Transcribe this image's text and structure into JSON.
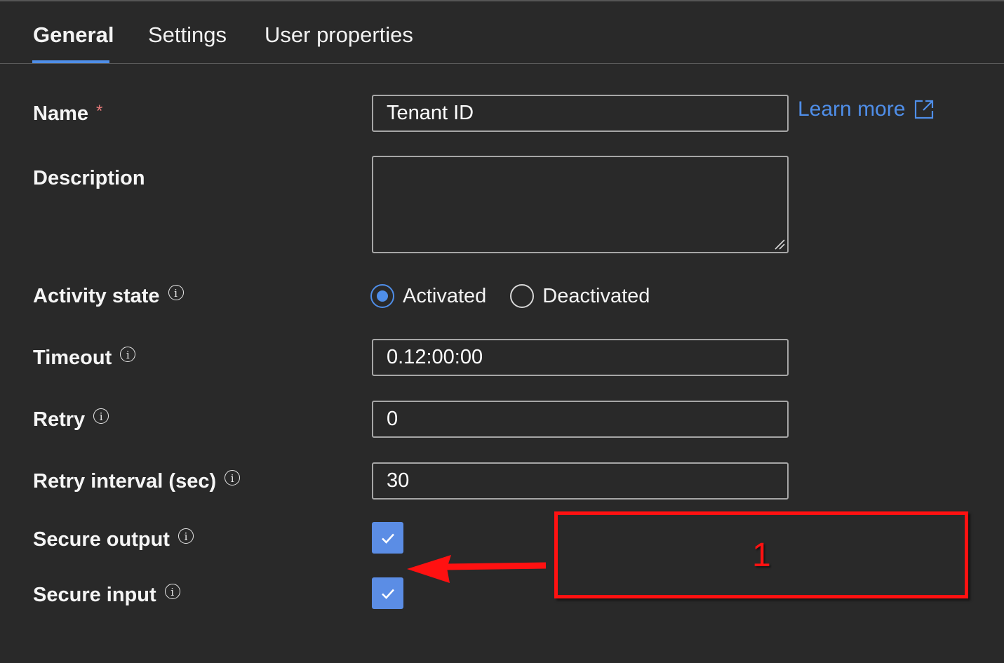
{
  "tabs": [
    {
      "label": "General",
      "active": true
    },
    {
      "label": "Settings",
      "active": false
    },
    {
      "label": "User properties",
      "active": false
    }
  ],
  "form": {
    "name": {
      "label": "Name",
      "required_mark": "*",
      "value": "Tenant ID"
    },
    "learn_more": {
      "label": "Learn more",
      "icon": "external-link-icon"
    },
    "description": {
      "label": "Description",
      "value": ""
    },
    "activity_state": {
      "label": "Activity state",
      "info_icon": "i",
      "options": [
        {
          "label": "Activated",
          "selected": true
        },
        {
          "label": "Deactivated",
          "selected": false
        }
      ]
    },
    "timeout": {
      "label": "Timeout",
      "info_icon": "i",
      "value": "0.12:00:00"
    },
    "retry": {
      "label": "Retry",
      "info_icon": "i",
      "value": "0"
    },
    "retry_interval": {
      "label": "Retry interval (sec)",
      "info_icon": "i",
      "value": "30"
    },
    "secure_output": {
      "label": "Secure output",
      "info_icon": "i",
      "checked": true
    },
    "secure_input": {
      "label": "Secure input",
      "info_icon": "i",
      "checked": true
    }
  },
  "annotation": {
    "number": "1",
    "color": "#ff1111"
  },
  "colors": {
    "background": "#292929",
    "accent": "#4f8ee8",
    "checkbox": "#5b8de5",
    "required": "#e77a7a"
  }
}
